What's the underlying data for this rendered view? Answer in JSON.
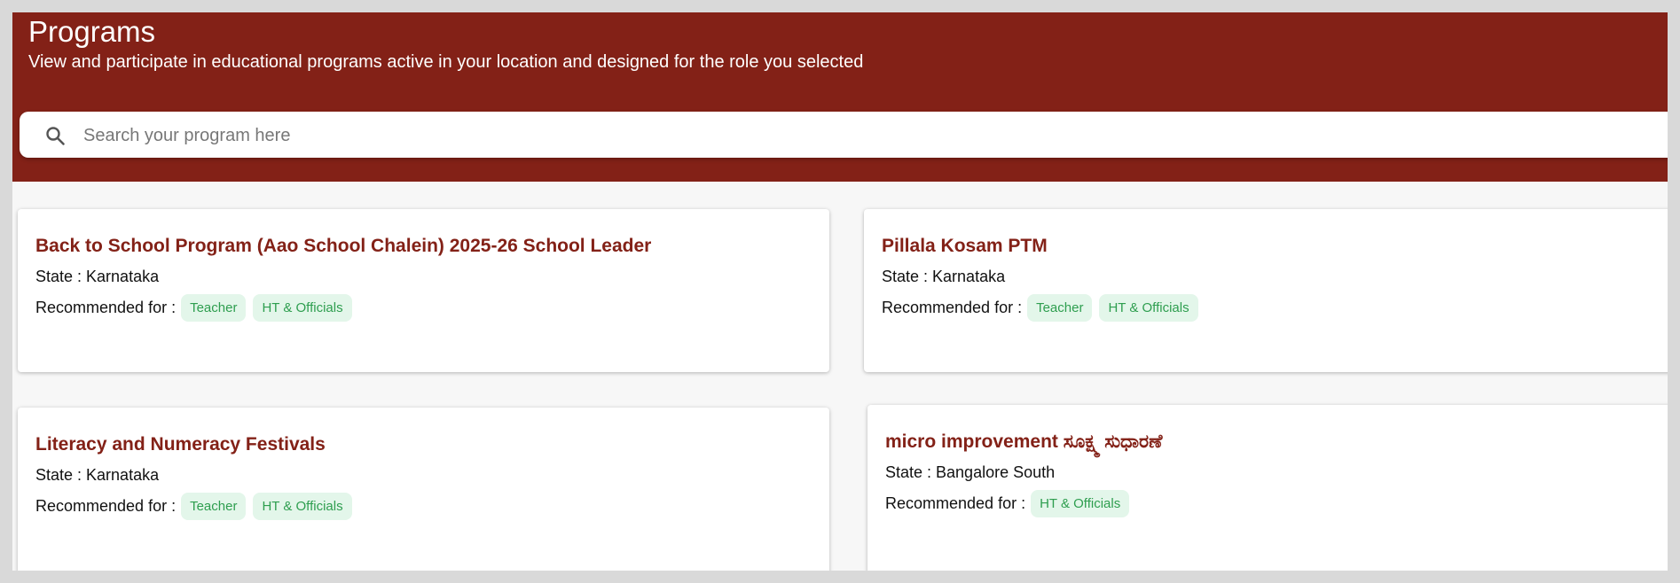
{
  "header": {
    "title": "Programs",
    "subtitle": "View and participate in educational programs active in your location and designed for the role you selected"
  },
  "search": {
    "placeholder": "Search your program here",
    "value": "",
    "icon": "search-icon"
  },
  "labels": {
    "state_prefix": "State : ",
    "recommended_for": "Recommended for :"
  },
  "colors": {
    "header_bg": "#832117",
    "title_text": "#832117",
    "chip_bg": "#e3f6ea",
    "chip_text": "#2e9e4f"
  },
  "programs": [
    {
      "title": "Back to School Program (Aao School Chalein) 2025-26 School Leader",
      "state": "State : Karnataka",
      "recommended": [
        "Teacher",
        "HT & Officials"
      ]
    },
    {
      "title": "Pillala Kosam PTM",
      "state": "State : Karnataka",
      "recommended": [
        "Teacher",
        "HT & Officials"
      ]
    },
    {
      "title": "Literacy and Numeracy Festivals",
      "state": "State : Karnataka",
      "recommended": [
        "Teacher",
        "HT & Officials"
      ]
    },
    {
      "title": "micro improvement ಸೂಕ್ಷ್ಮ ಸುಧಾರಣೆ",
      "state": "State : Bangalore South",
      "recommended": [
        "HT & Officials"
      ]
    }
  ]
}
